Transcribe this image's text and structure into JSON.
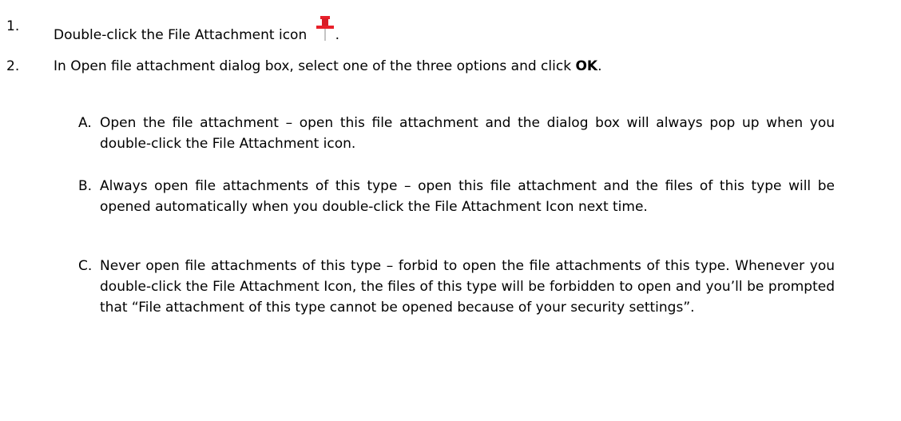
{
  "steps": [
    {
      "number": "1.",
      "text_before": "Double-click the File Attachment icon",
      "text_after": ".",
      "icon": "pushpin-icon"
    },
    {
      "number": "2.",
      "text_before": "In Open file attachment dialog box, select one of the three options and click ",
      "bold": "OK",
      "text_after": "."
    }
  ],
  "options": [
    {
      "letter": "A.",
      "text": "Open the file attachment – open this file attachment and the dialog box will always pop up when you double-click the File Attachment icon."
    },
    {
      "letter": "B.",
      "text": "Always open file attachments of this type – open this file attachment and the files of this type will be opened automatically when you double-click the File Attachment Icon next time."
    },
    {
      "letter": "C.",
      "text": "Never open file attachments of this type – forbid to open the file attachments of this type. Whenever you double-click the File Attachment Icon, the files of this type will be forbidden to open and you’ll be prompted that “File attachment of this type cannot be opened because of your security settings”."
    }
  ],
  "colors": {
    "pin": "#e8202a",
    "text": "#000000"
  }
}
